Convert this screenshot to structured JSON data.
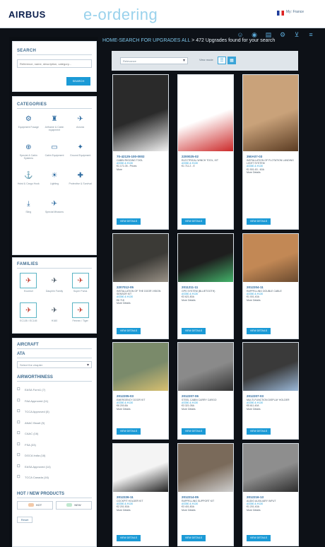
{
  "header": {
    "logo": "AIRBUS",
    "brand": "e-ordering",
    "language": "My: France"
  },
  "breadcrumb": {
    "path": "HOME-SEARCH FOR UPGRADES ALL",
    "results": " > 472 Upgrades found for your search"
  },
  "sidebar": {
    "search": {
      "title": "SEARCH",
      "placeholder": "Reference, name, description, category...",
      "button": "SEARCH"
    },
    "categories": {
      "title": "CATEGORIES",
      "items": [
        {
          "label": "Equipment Fusage",
          "icon": "equipment-icon"
        },
        {
          "label": "Airframe & Cabin equipment",
          "icon": "seat-icon"
        },
        {
          "label": "Avionic",
          "icon": "aircraft-icon"
        },
        {
          "label": "Special & Cabin Systems",
          "icon": "rotor-icon"
        },
        {
          "label": "Cabin Equipment",
          "icon": "cabin-icon"
        },
        {
          "label": "Ground Equipment",
          "icon": "ground-icon"
        },
        {
          "label": "Hoist & Cargo Hook",
          "icon": "hook-icon"
        },
        {
          "label": "Lighting",
          "icon": "lighting-icon"
        },
        {
          "label": "Protective & Survival",
          "icon": "survival-icon"
        },
        {
          "label": "Sling",
          "icon": "sling-icon"
        },
        {
          "label": "Special Missions",
          "icon": "mission-icon"
        }
      ]
    },
    "families": {
      "title": "FAMILIES",
      "items": [
        {
          "label": "Ecureuil",
          "framed": true
        },
        {
          "label": "Dauphin Family",
          "framed": false
        },
        {
          "label": "Super Puma",
          "framed": true
        },
        {
          "label": "EC135 / EC145",
          "framed": true
        },
        {
          "label": "H160",
          "framed": false
        },
        {
          "label": "Fennec / Tiger",
          "framed": true
        }
      ]
    },
    "aircraft": {
      "title": "AIRCRAFT"
    },
    "ata": {
      "title": "ATA",
      "placeholder": "Select the chapter"
    },
    "airworthiness": {
      "title": "AIRWORTHINESS",
      "items": [
        {
          "label": "EASA Form1 (7)"
        },
        {
          "label": "FAA Approved (11)"
        },
        {
          "label": "TCCA Approved (5)"
        },
        {
          "label": "ANAC Brazil (9)"
        },
        {
          "label": "CAAC (16)"
        },
        {
          "label": "FSA (33)"
        },
        {
          "label": "DGCA India (18)"
        },
        {
          "label": "EASA Approved (14)"
        },
        {
          "label": "TCCA Canada (16)"
        }
      ]
    },
    "hot_new": {
      "title": "HOT / NEW PRODUCTS",
      "hot": "HOT",
      "new": "NEW"
    },
    "reset": "Reset"
  },
  "toolbar": {
    "sort_placeholder": "Relevance",
    "view_label": "View mode"
  },
  "cards": [
    {
      "pn": "70-42125-100-0002",
      "desc": "Cabin Rigging Tool",
      "models": "AS350 & H130",
      "price": "€1 171.05 - Prices",
      "stock": "More",
      "btn": "VIEW DETAILS"
    },
    {
      "pn": "2200025-02",
      "desc": "Electrical Winch Tool, Kit",
      "models": "AS350 & H130",
      "price": "€1 711.2 - E",
      "stock": "",
      "btn": "VIEW DETAILS"
    },
    {
      "pn": "350A07-03",
      "desc": "Installation of Flotation Landing Light System",
      "models": "AS350 & H130",
      "price": "€1 501.63 - 60A",
      "stock": "More Details",
      "btn": "VIEW DETAILS"
    },
    {
      "pn": "2207012-05",
      "desc": "Installation of the Door Vision Sensor Kit",
      "models": "AS350 & H130",
      "price": "€6 718",
      "stock": "More Details",
      "btn": "VIEW DETAILS"
    },
    {
      "pn": "2011211-11",
      "desc": "GPS System (Bluetooth)",
      "models": "AS350 & H130",
      "price": "€3 621.80A",
      "stock": "More Details",
      "btn": "VIEW DETAILS"
    },
    {
      "pn": "2012204-11",
      "desc": "Rappelling Double Cable",
      "models": "AS350 & H130",
      "price": "€1 001.40A",
      "stock": "More Details",
      "btn": "VIEW DETAILS"
    },
    {
      "pn": "2012205-03",
      "desc": "EMERGENCY DOOR Kit",
      "models": "AS350 & H130",
      "price": "€6 200.8A",
      "stock": "More Details",
      "btn": "VIEW DETAILS"
    },
    {
      "pn": "2012207-06",
      "desc": "Steel Cabin Carry Cargo",
      "models": "AS350 & H130",
      "price": "€3 321.05A",
      "stock": "More Details",
      "btn": "VIEW DETAILS"
    },
    {
      "pn": "2012207-03",
      "desc": "Multi-Function Display Holder",
      "models": "AS350 & H130",
      "price": "€5 611.40A",
      "stock": "More Details",
      "btn": "VIEW DETAILS"
    },
    {
      "pn": "2012226-11",
      "desc": "Cockpit Holder Kit",
      "models": "AS350 & H130",
      "price": "€2 201.50A",
      "stock": "More Details",
      "btn": "VIEW DETAILS"
    },
    {
      "pn": "2012214-05",
      "desc": "Rappelling Support Kit",
      "models": "AS350 & H130",
      "price": "€3 401.80A",
      "stock": "More Details",
      "btn": "VIEW DETAILS"
    },
    {
      "pn": "2012216-13",
      "desc": "Audio Auxiliary Input",
      "models": "AS350 & H130",
      "price": "€1 201.40A",
      "stock": "More Details",
      "btn": "VIEW DETAILS"
    }
  ]
}
